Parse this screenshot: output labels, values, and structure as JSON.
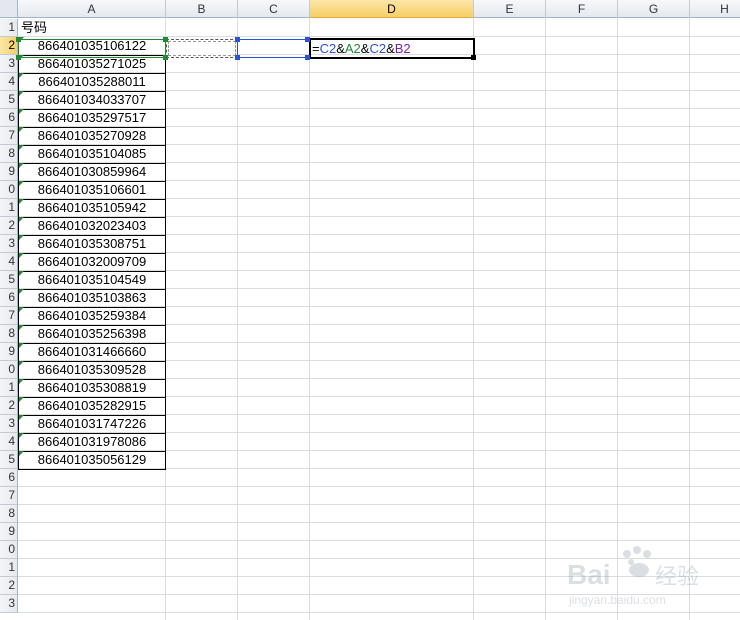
{
  "columns": [
    "A",
    "B",
    "C",
    "D",
    "E",
    "F",
    "G",
    "H"
  ],
  "selected_column": "D",
  "row_numbers": [
    "1",
    "2",
    "3",
    "4",
    "5",
    "6",
    "7",
    "8",
    "9",
    "0",
    "1",
    "2",
    "3",
    "4",
    "5",
    "6",
    "7",
    "8",
    "9",
    "0",
    "1",
    "2",
    "3",
    "4",
    "5",
    "6",
    "7",
    "8",
    "9",
    "0",
    "1",
    "2",
    "3"
  ],
  "selected_row": "2",
  "header_cell": "号码",
  "numbers": [
    "866401035106122",
    "866401035271025",
    "866401035288011",
    "866401034033707",
    "866401035297517",
    "866401035270928",
    "866401035104085",
    "866401030859964",
    "866401035106601",
    "866401035105942",
    "866401032023403",
    "866401035308751",
    "866401032009709",
    "866401035104549",
    "866401035103863",
    "866401035259384",
    "866401035256398",
    "866401031466660",
    "866401035309528",
    "866401035308819",
    "866401035282915",
    "866401031747226",
    "866401031978086",
    "866401035056129"
  ],
  "formula": {
    "eq": "=",
    "c1": "C2",
    "amp1": "&",
    "a": "A2",
    "amp2": "&",
    "c2": "C2",
    "amp3": "&",
    "b": "B2"
  },
  "colors": {
    "c_ref": "#2b53d8",
    "a_ref": "#1e8a34",
    "b_ref": "#7f1fae",
    "header_selected": "#f7cf63"
  },
  "watermark": {
    "brand": "Bai",
    "suffix": "经验",
    "url": "jingyan.baidu.com"
  }
}
